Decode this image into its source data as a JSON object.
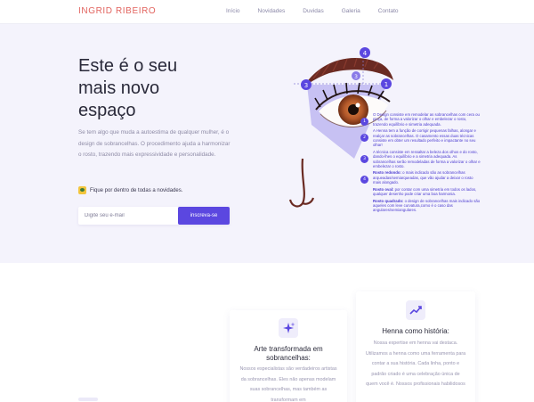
{
  "nav": {
    "logo": "INGRID RIBEIRO",
    "links": [
      "Início",
      "Novidades",
      "Duvidas",
      "Galeria",
      "Contato"
    ]
  },
  "hero": {
    "title_lines": [
      "Este é o seu",
      "mais novo",
      "espaço"
    ],
    "description": "Se tem algo que muda a autoestima de qualquer mulher, é o design de sobrancelhas. O procedimento ajuda a harmonizar o rosto, trazendo mais expressividade e personalidade.",
    "note": "Fique por dentro de todas a novidades.",
    "email_placeholder": "Digite seu e-mail",
    "subscribe_label": "inscreva-se"
  },
  "illustration": {
    "markers": [
      "1",
      "2",
      "3",
      "4"
    ],
    "annotations": [
      {
        "num": "1",
        "text": "O Design consiste em remodelar as sobrancelhas com cera ou pinça, de forma a valorizar o olhar e embelezar o rosto, trazendo equilíbrio e simetria adequada."
      },
      {
        "num": "2",
        "text": "A Henna tem a função de corrigir pequenas falhas, alongar e realçar as sobrancelhas. O casamento essas duas técnicas consiste em obter um resultado perfeito e impactante no seu olhar!"
      },
      {
        "num": "3",
        "text": "A técnica consiste em ressaltar a beleza dos olhos e do rosto, dando-lhes o equilíbrio e a simetria adequada. As sobrancelhas serão remodeladas de forma a valorizar o olhar e embelezar o rosto."
      },
      {
        "num": "4",
        "text_bold": "Rosto redondo:",
        "text": " o mais indicado são as sobrancelhas arqueadas/semiarqueadas, que vão ajudar a deixar o rosto mais alongado."
      }
    ],
    "extra_notes": [
      {
        "bold": "Rosto oval:",
        "text": " por contar com uma simetria em todos os lados, qualquer desenho pode criar uma boa harmonia."
      },
      {
        "bold": "Rosto quadrado:",
        "text": " o design de sobrancelhas mais indicado são aqueles com leve curvatura,como é o caso das angulares/semiangulares."
      }
    ]
  },
  "features": {
    "cards": [
      {
        "icon": "sparkle-icon",
        "title": "Arte transformada em sobrancelhas:",
        "text": "Nossos especialistas são verdadeiros artistas da sobrancelhas. Eles não apenas modelam suas sobrancelhas, mas também as transformam em"
      },
      {
        "icon": "trending-up-icon",
        "title": "Henna como história:",
        "text": "Nossa expertise em henna vai destaca. Utilizamos a henna como uma ferramenta para contar a sua história. Cada linha, ponto e padrão criado é uma celebração única de quem você é. Nossos profissionais habilidosos"
      }
    ]
  },
  "colors": {
    "accent": "#5b47e0",
    "logo": "#e2645f",
    "hero_bg": "#f4f3fc",
    "brow": "#6a2a22",
    "iris": "#b4592a"
  }
}
